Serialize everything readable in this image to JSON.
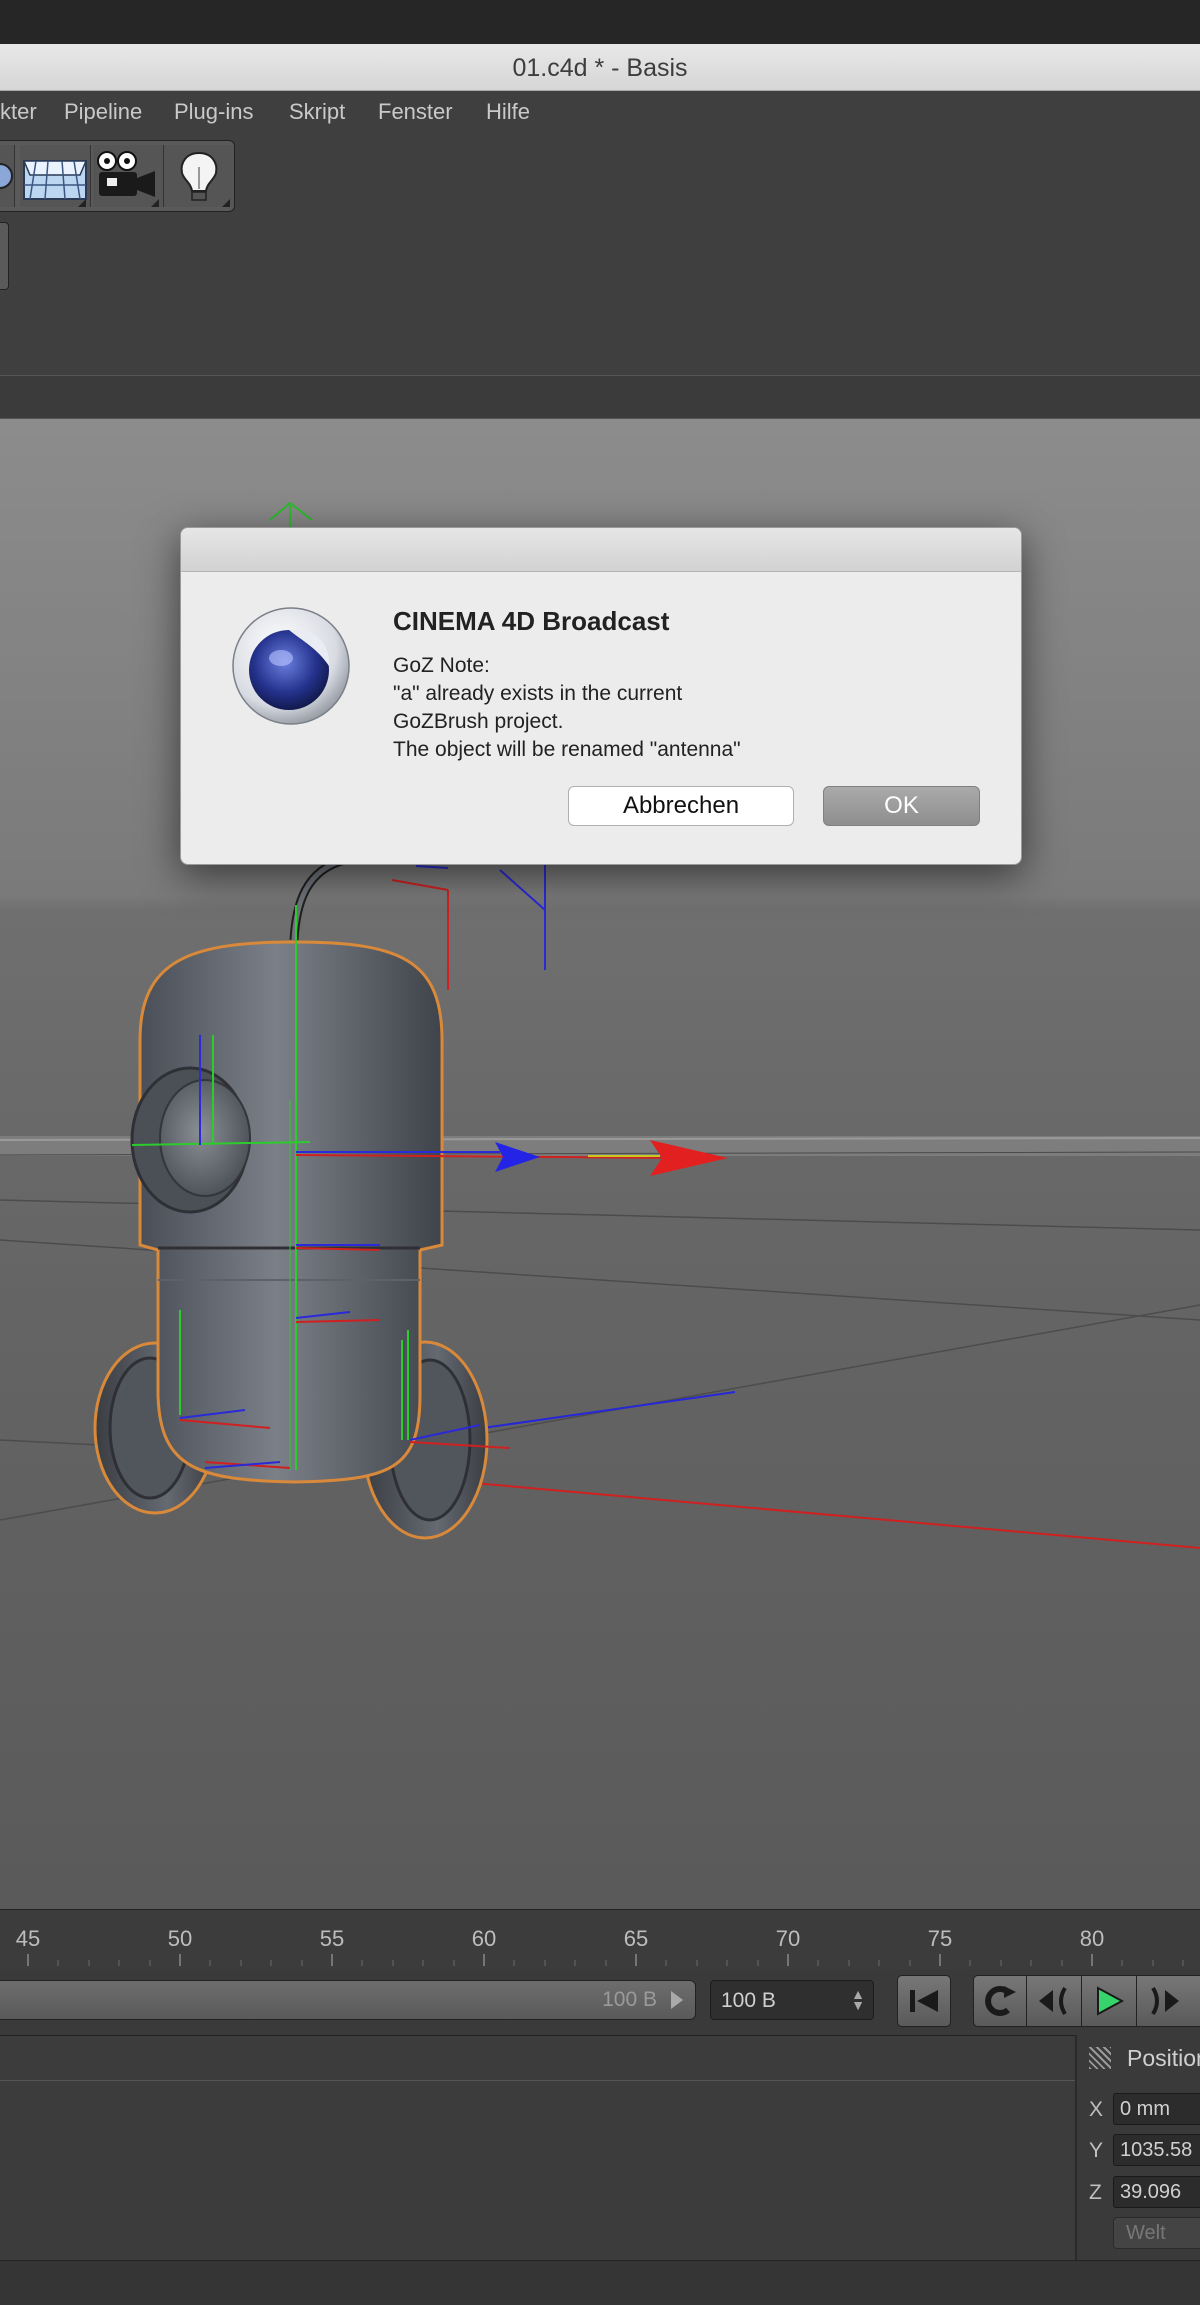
{
  "window": {
    "title": "01.c4d * - Basis"
  },
  "menu": {
    "items": [
      "kter",
      "Pipeline",
      "Plug-ins",
      "Skript",
      "Fenster",
      "Hilfe"
    ]
  },
  "toolbar": {
    "icons": [
      "primitive-icon",
      "floor-icon",
      "camera-icon",
      "light-icon"
    ]
  },
  "timeline": {
    "ticks": [
      "45",
      "50",
      "55",
      "60",
      "65",
      "70",
      "75",
      "80"
    ]
  },
  "controls": {
    "frame_slider_value": "100 B",
    "frame_field_value": "100 B",
    "buttons": [
      "go-to-start-icon",
      "loop-icon",
      "prev-key-icon",
      "play-icon",
      "next-key-icon"
    ]
  },
  "coordinates": {
    "header": "Position",
    "x_label": "X",
    "x_value": "0 mm",
    "y_label": "Y",
    "y_value": "1035.58",
    "z_label": "Z",
    "z_value": "39.096",
    "mode": "Welt"
  },
  "dialog": {
    "title": "CINEMA 4D Broadcast",
    "lines": [
      "GoZ Note:",
      "\"a\" already exists in the current",
      "GoZBrush project.",
      "The object will be renamed \"antenna\""
    ],
    "cancel_label": "Abbrechen",
    "ok_label": "OK"
  },
  "colors": {
    "accent_orange": "#d9893a",
    "axis_red": "#e02525",
    "axis_green": "#2dc52d",
    "axis_blue": "#2a2ae0"
  }
}
